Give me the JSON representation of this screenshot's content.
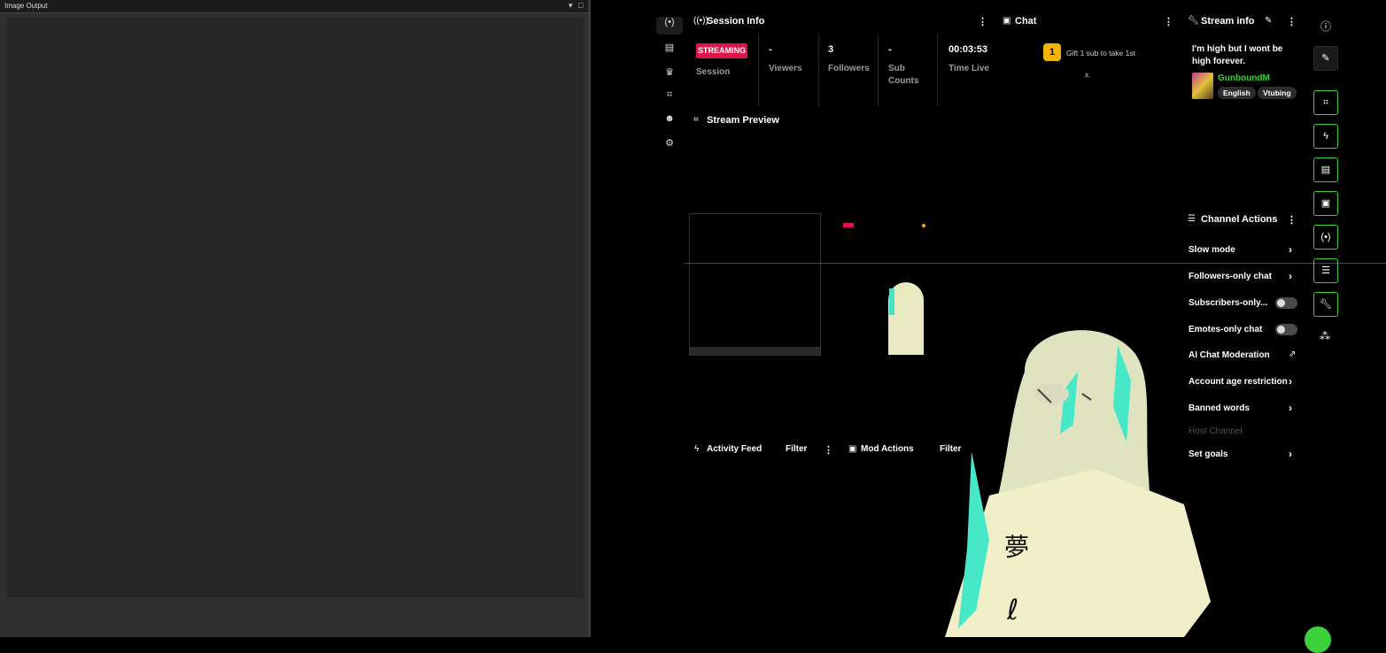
{
  "left_window": {
    "title": "Image Output",
    "minimize_glyph": "▾",
    "maximize_glyph": "□"
  },
  "nav_rail": {
    "items": [
      {
        "icon": "broadcast-icon",
        "glyph": "(•)"
      },
      {
        "icon": "stats-icon",
        "glyph": "▤"
      },
      {
        "icon": "trophy-icon",
        "glyph": "♛"
      },
      {
        "icon": "camera-icon",
        "glyph": "⌗"
      },
      {
        "icon": "users-icon",
        "glyph": "☻"
      },
      {
        "icon": "settings-icon",
        "glyph": "⚙"
      }
    ]
  },
  "session_info": {
    "title": "Session Info",
    "status_badge": "STREAMING",
    "session_label": "Session",
    "stats": [
      {
        "value": "-",
        "label": "Viewers"
      },
      {
        "value": "3",
        "label": "Followers"
      },
      {
        "value": "-",
        "label_line1": "Sub",
        "label_line2": "Counts"
      },
      {
        "value": "00:03:53",
        "label": "Time Live"
      }
    ]
  },
  "chat": {
    "title": "Chat",
    "gift_rank": "1",
    "gift_text": "Gift 1 sub to take 1st"
  },
  "stream_info": {
    "title": "Stream info",
    "stream_title_line1": "I'm high but I wont be",
    "stream_title_line2": "high forever.",
    "channel_name": "GunboundM",
    "tags": [
      "English",
      "Vtubing"
    ],
    "accent_color": "#3ad13a"
  },
  "stream_preview": {
    "title": "Stream Preview"
  },
  "channel_actions": {
    "title": "Channel Actions",
    "items": [
      {
        "label": "Slow mode",
        "control": "arrow"
      },
      {
        "label": "Followers-only chat",
        "control": "arrow"
      },
      {
        "label": "Subscribers-only...",
        "control": "toggle"
      },
      {
        "label": "Emotes-only chat",
        "control": "toggle"
      },
      {
        "label": "AI Chat Moderation",
        "control": "external"
      },
      {
        "label": "Account age restriction",
        "control": "arrow"
      },
      {
        "label": "Banned words",
        "control": "arrow"
      },
      {
        "label": "Host Channel",
        "control": "none"
      },
      {
        "label": "Set goals",
        "control": "arrow"
      }
    ]
  },
  "activity_feed": {
    "title": "Activity Feed",
    "filter_label": "Filter"
  },
  "mod_actions": {
    "title": "Mod Actions",
    "filter_label": "Filter"
  },
  "right_rail": {
    "buttons": [
      {
        "icon": "info-icon"
      },
      {
        "icon": "pencil-icon"
      },
      {
        "icon": "camera-icon"
      },
      {
        "icon": "lightning-icon"
      },
      {
        "icon": "note-icon"
      },
      {
        "icon": "chat-icon"
      },
      {
        "icon": "broadcast-icon"
      },
      {
        "icon": "layout-icon"
      },
      {
        "icon": "wrench-icon"
      },
      {
        "icon": "community-icon"
      }
    ]
  }
}
